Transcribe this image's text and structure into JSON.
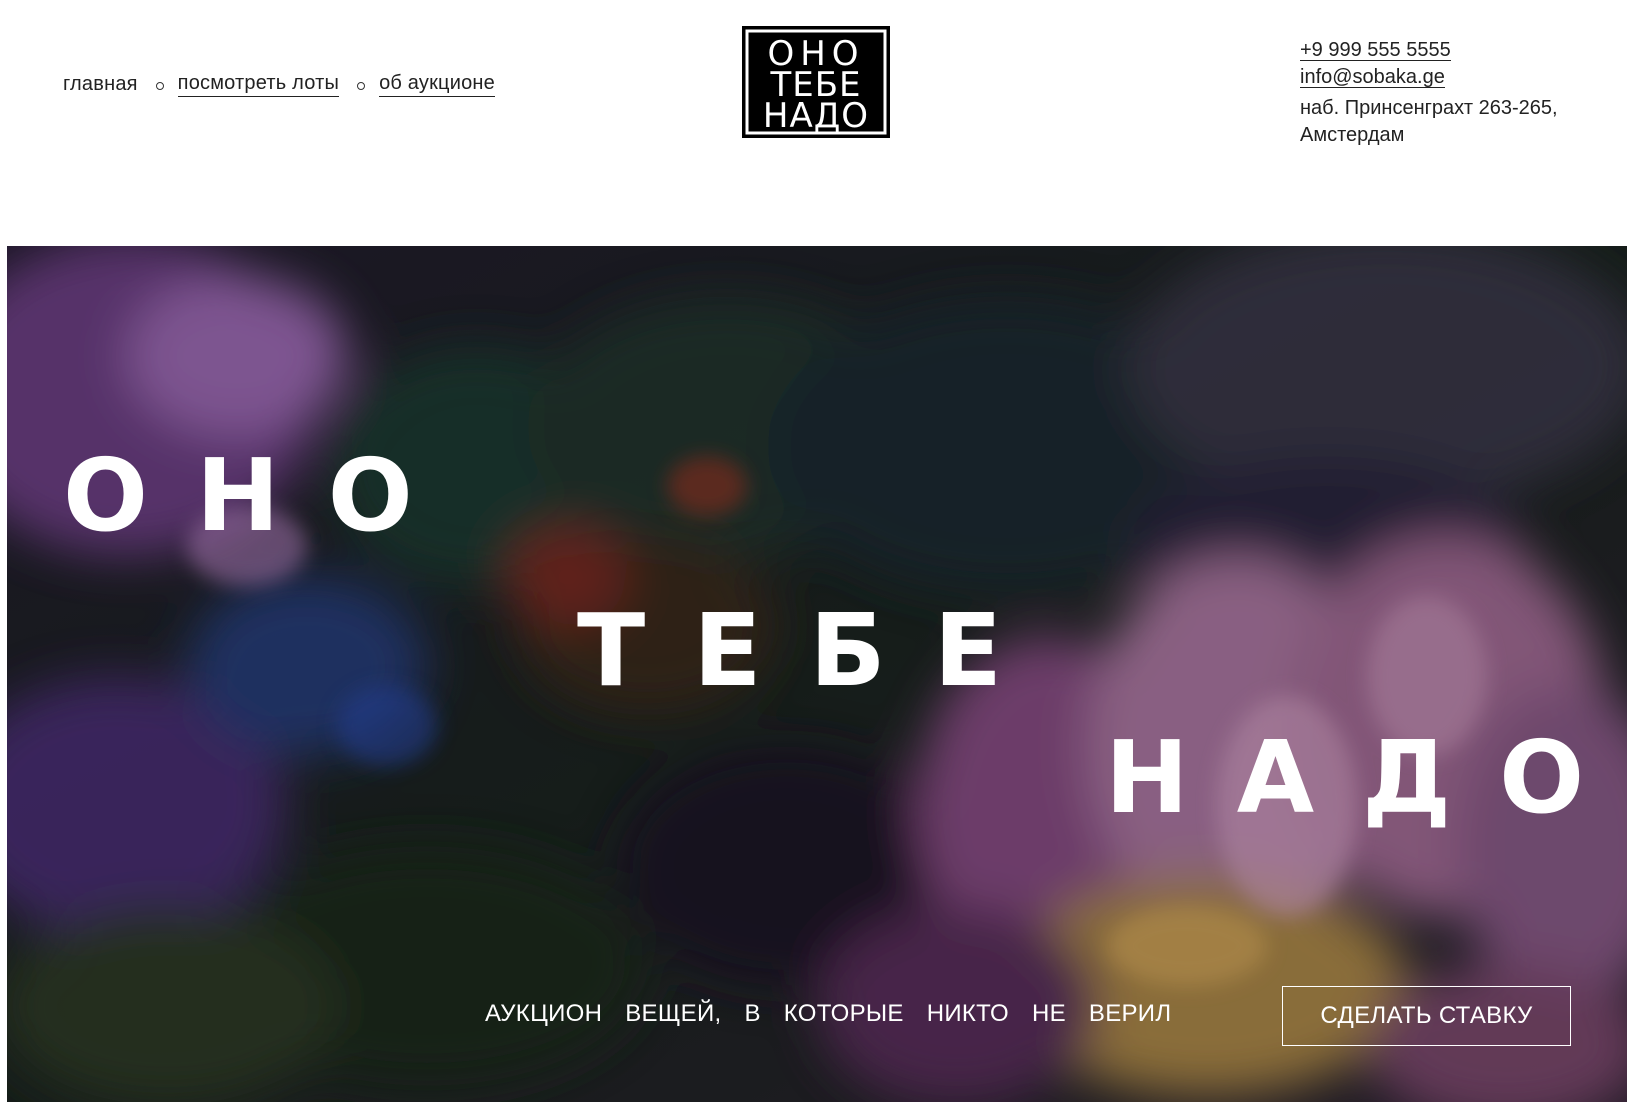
{
  "nav": {
    "items": [
      {
        "label": "главная"
      },
      {
        "label": "посмотреть лоты"
      },
      {
        "label": "об аукционе"
      }
    ]
  },
  "logo": {
    "lines": [
      "ОНО",
      "ТЕБЕ",
      "НАДО"
    ]
  },
  "contacts": {
    "phone": "+9 999 555 5555",
    "email": "info@sobaka.ge",
    "address": "наб. Принсенграхт 263-265, Амстердам"
  },
  "hero": {
    "words": [
      "ОНО",
      "ТЕБЕ",
      "НАДО"
    ],
    "tagline": "АУКЦИОН ВЕЩЕЙ, В КОТОРЫЕ НИКТО НЕ ВЕРИЛ",
    "cta_label": "СДЕЛАТЬ СТАВКУ"
  },
  "colors": {
    "text": "#222222",
    "hero_text": "#ffffff",
    "logo_bg": "#000000"
  }
}
